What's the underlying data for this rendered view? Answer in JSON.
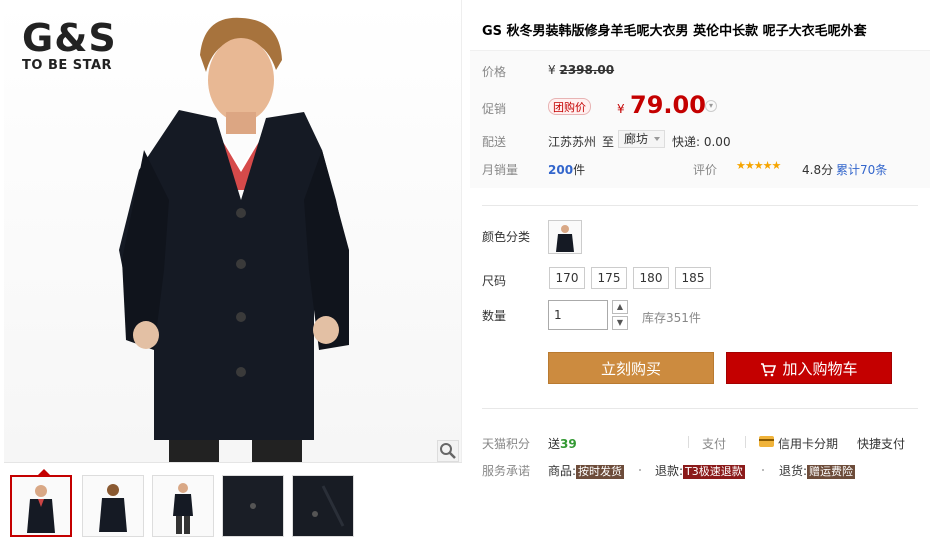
{
  "brand": {
    "logo_big": "G&S",
    "logo_small": "TO BE STAR"
  },
  "product": {
    "title": "GS 秋冬男装韩版修身羊毛呢大衣男 英伦中长款 呢子大衣毛呢外套"
  },
  "price": {
    "label": "价格",
    "currency": "¥",
    "original": "2398.00"
  },
  "promo": {
    "label": "促销",
    "tag": "团购价",
    "currency": "¥",
    "price": "79.00"
  },
  "shipping": {
    "label": "配送",
    "from": "江苏苏州",
    "to_word": "至",
    "city": "廊坊",
    "express": "快递: 0.00"
  },
  "sales": {
    "label": "月销量",
    "count": "200",
    "unit": "件",
    "review_label": "评价",
    "stars": "★★★★★",
    "score": "4.8分",
    "total": "累计70条"
  },
  "options": {
    "color_label": "颜色分类",
    "size_label": "尺码",
    "sizes": [
      "170",
      "175",
      "180",
      "185"
    ],
    "qty_label": "数量",
    "qty_value": "1",
    "qty_up": "▲",
    "qty_down": "▼",
    "stock": "库存351件"
  },
  "actions": {
    "buy_now": "立刻购买",
    "add_cart": "加入购物车"
  },
  "points": {
    "label": "天猫积分",
    "send": "送",
    "value": "39",
    "pay_label": "支付",
    "credit": "信用卡分期",
    "quick_pay": "快捷支付"
  },
  "promise": {
    "label": "服务承诺",
    "goods_label": "商品:",
    "goods_tag": "按时发货",
    "return_label": "退款:",
    "return_tag": "T3极速退款",
    "freight_label": "退货:",
    "freight_tag": "赠运费险"
  },
  "colors": {
    "accent_red": "#c40000",
    "buy_orange": "#cc8b3f",
    "link_blue": "#3366cc",
    "star_gold": "#f6a500"
  },
  "icons": [
    "zoom-icon",
    "cart-icon",
    "credit-card-icon",
    "dropdown-chevron-icon"
  ]
}
